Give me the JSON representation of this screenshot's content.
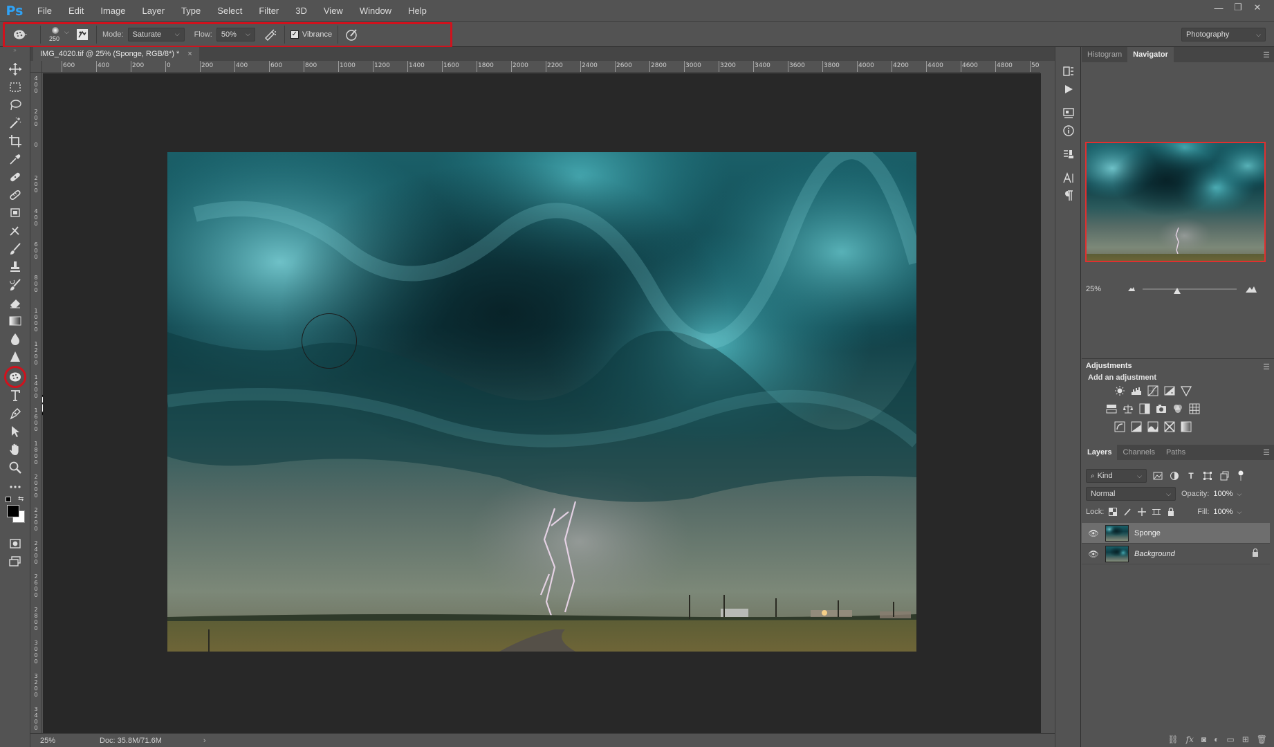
{
  "app": {
    "logo": "Ps"
  },
  "menu": [
    "File",
    "Edit",
    "Image",
    "Layer",
    "Type",
    "Select",
    "Filter",
    "3D",
    "View",
    "Window",
    "Help"
  ],
  "window_controls": {
    "minimize": "—",
    "restore": "❐",
    "close": "✕"
  },
  "options": {
    "brush_size": "250",
    "mode_label": "Mode:",
    "mode_value": "Saturate",
    "flow_label": "Flow:",
    "flow_value": "50%",
    "vibrance_label": "Vibrance",
    "vibrance_checked": "✓",
    "workspace": "Photography"
  },
  "document": {
    "tab_title": "IMG_4020.tif @ 25% (Sponge, RGB/8*) *",
    "close": "×",
    "status_zoom": "25%",
    "status_doc": "Doc: 35.8M/71.6M",
    "status_arrow": "›"
  },
  "rulers": {
    "horizontal": [
      "600",
      "400",
      "200",
      "0",
      "200",
      "400",
      "600",
      "800",
      "1000",
      "1200",
      "1400",
      "1600",
      "1800",
      "2000",
      "2200",
      "2400",
      "2600",
      "2800",
      "3000",
      "3200",
      "3400",
      "3600",
      "3800",
      "4000",
      "4200",
      "4400",
      "4600",
      "4800",
      "50"
    ],
    "vertical": [
      "400",
      "200",
      "0",
      "200",
      "400",
      "600",
      "800",
      "1000",
      "1200",
      "1400",
      "1600",
      "1800",
      "2000",
      "2200",
      "2400",
      "2600",
      "2800",
      "3000",
      "3200",
      "3400"
    ]
  },
  "navigator": {
    "tabs": [
      "Histogram",
      "Navigator"
    ],
    "active_tab": "Navigator",
    "zoom": "25%"
  },
  "adjustments": {
    "title": "Adjustments",
    "subtitle": "Add an adjustment"
  },
  "layers": {
    "tabs": [
      "Layers",
      "Channels",
      "Paths"
    ],
    "kind": "Kind",
    "blend_mode": "Normal",
    "opacity_label": "Opacity:",
    "opacity_value": "100%",
    "lock_label": "Lock:",
    "fill_label": "Fill:",
    "fill_value": "100%",
    "items": [
      {
        "name": "Sponge",
        "visible": true,
        "selected": true,
        "locked": false
      },
      {
        "name": "Background",
        "visible": true,
        "selected": false,
        "locked": true
      }
    ]
  },
  "colors": {
    "highlight": "#d0121d",
    "accent": "#2fa3f7",
    "canvas": "#282828",
    "panel": "#535353"
  }
}
